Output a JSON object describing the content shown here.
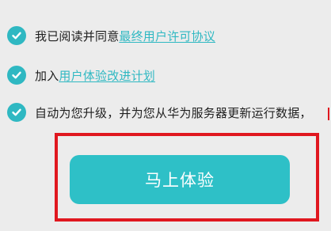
{
  "agreements": [
    {
      "prefix": "我已阅读并同意",
      "link": "最终用户许可协议",
      "icon": "check-circle-icon",
      "checked": true
    },
    {
      "prefix": "加入",
      "link": "用户体验改进计划",
      "icon": "check-circle-icon",
      "checked": true
    },
    {
      "prefix": "自动为您升级，并为您从华为服务器更新运行数据，",
      "link": "",
      "icon": "check-circle-icon",
      "checked": true
    }
  ],
  "cta": {
    "label": "马上体验"
  },
  "colors": {
    "accent": "#2fb8c2",
    "button": "#2ec0c7",
    "highlight": "#e0171f",
    "background": "#ececec"
  }
}
